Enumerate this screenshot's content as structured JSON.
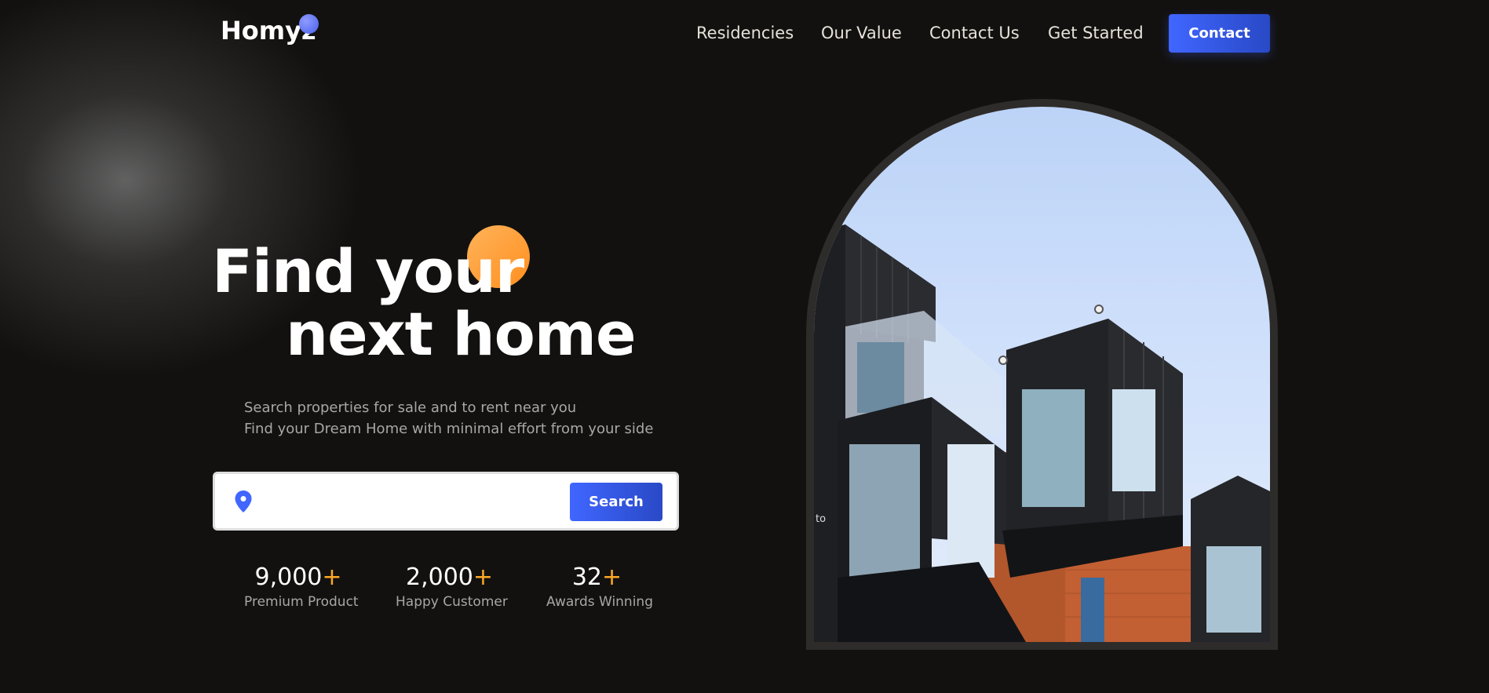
{
  "header": {
    "logo": "Homyz",
    "nav": [
      "Residencies",
      "Our Value",
      "Contact Us",
      "Get Started"
    ],
    "contact_button": "Contact"
  },
  "hero": {
    "title_line1": "Find your",
    "title_line2": "next home",
    "description_line1": "Search properties for sale and to rent near you",
    "description_line2": "Find your Dream Home with minimal effort from your side",
    "search": {
      "placeholder": "",
      "button": "Search",
      "icon": "location-pin-icon"
    },
    "stats": [
      {
        "value": "9,000",
        "suffix": "+",
        "label": "Premium Product"
      },
      {
        "value": "2,000",
        "suffix": "+",
        "label": "Happy Customer"
      },
      {
        "value": "32",
        "suffix": "+",
        "label": "Awards Winning"
      }
    ],
    "image_caption_fragment": "to"
  },
  "colors": {
    "accent_blue": "#4066ff",
    "accent_orange": "#ffa726",
    "background": "#131110"
  }
}
